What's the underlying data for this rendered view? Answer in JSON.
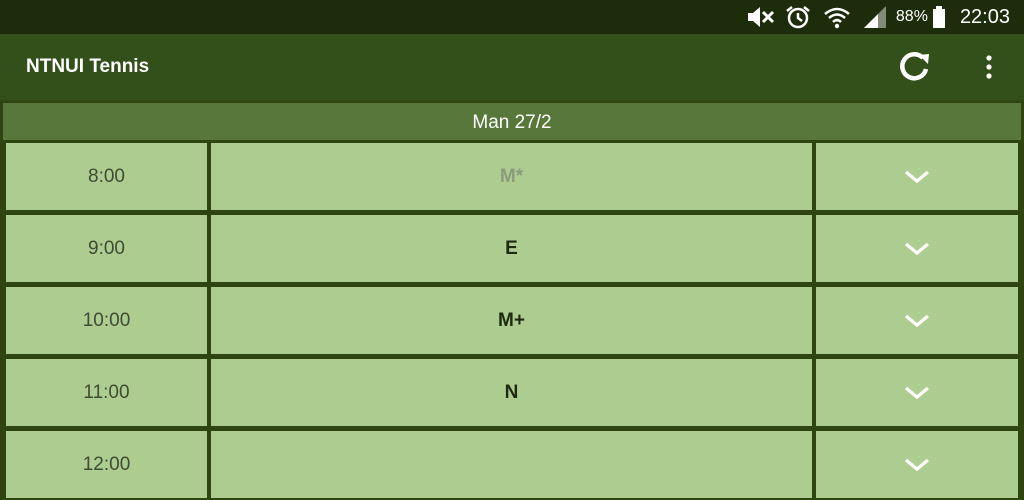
{
  "status_bar": {
    "battery": "88%",
    "clock": "22:03",
    "icons": [
      "mute-icon",
      "alarm-icon",
      "wifi-icon",
      "signal-icon",
      "battery-icon"
    ]
  },
  "app_bar": {
    "title": "NTNUI Tennis",
    "actions": [
      "refresh-icon",
      "more-vert-icon"
    ]
  },
  "schedule": {
    "date": "Man 27/2",
    "slots": [
      {
        "time": "8:00",
        "level": "M*"
      },
      {
        "time": "9:00",
        "level": "E"
      },
      {
        "time": "10:00",
        "level": "M+"
      },
      {
        "time": "11:00",
        "level": "N"
      },
      {
        "time": "12:00",
        "level": ""
      }
    ]
  },
  "colors": {
    "status_bar": "#1d2c0b",
    "app_bar": "#33501a",
    "date_header": "#58773a",
    "cell": "#adcc8f",
    "divider": "#2e4512"
  }
}
